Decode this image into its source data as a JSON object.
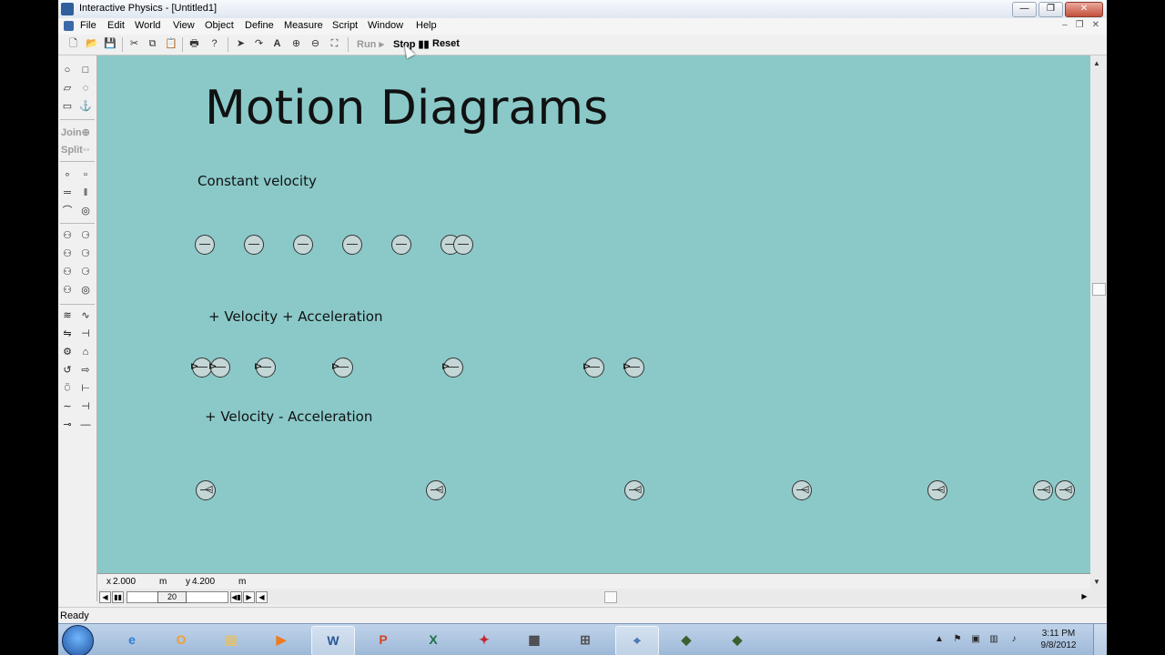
{
  "window": {
    "title": "Interactive Physics - [Untitled1]",
    "minimize": "—",
    "maximize": "❐",
    "close": "✕",
    "mdi_minimize": "–",
    "mdi_restore": "❐",
    "mdi_close": "✕"
  },
  "menu": [
    "File",
    "Edit",
    "World",
    "View",
    "Object",
    "Define",
    "Measure",
    "Script",
    "Window",
    "Help"
  ],
  "toolbar": {
    "run_label": "Run ▸",
    "stop_label": "Stop ▮▮",
    "reset_label": "Reset"
  },
  "palette": {
    "join_label": "Join⊕",
    "split_label": "Split◦◦"
  },
  "canvas": {
    "background": "#8bc9c9",
    "heading": "Motion Diagrams",
    "label_constant": "Constant velocity",
    "label_plus_accel": "+ Velocity + Acceleration",
    "label_minus_accel": "+ Velocity - Acceleration"
  },
  "coords": {
    "x_label": "x",
    "x_value": "2.000",
    "x_unit": "m",
    "y_label": "y",
    "y_value": "4.200",
    "y_unit": "m"
  },
  "frame": {
    "value": "20"
  },
  "status": {
    "text": "Ready"
  },
  "taskbar": {
    "apps": [
      "internet-explorer",
      "outlook",
      "file-explorer",
      "media-player",
      "word",
      "powerpoint",
      "excel",
      "sbx",
      "calculator",
      "network",
      "interactive-physics",
      "app-green",
      "app-green-red"
    ],
    "clock_time": "3:11 PM",
    "clock_date": "9/8/2012"
  }
}
